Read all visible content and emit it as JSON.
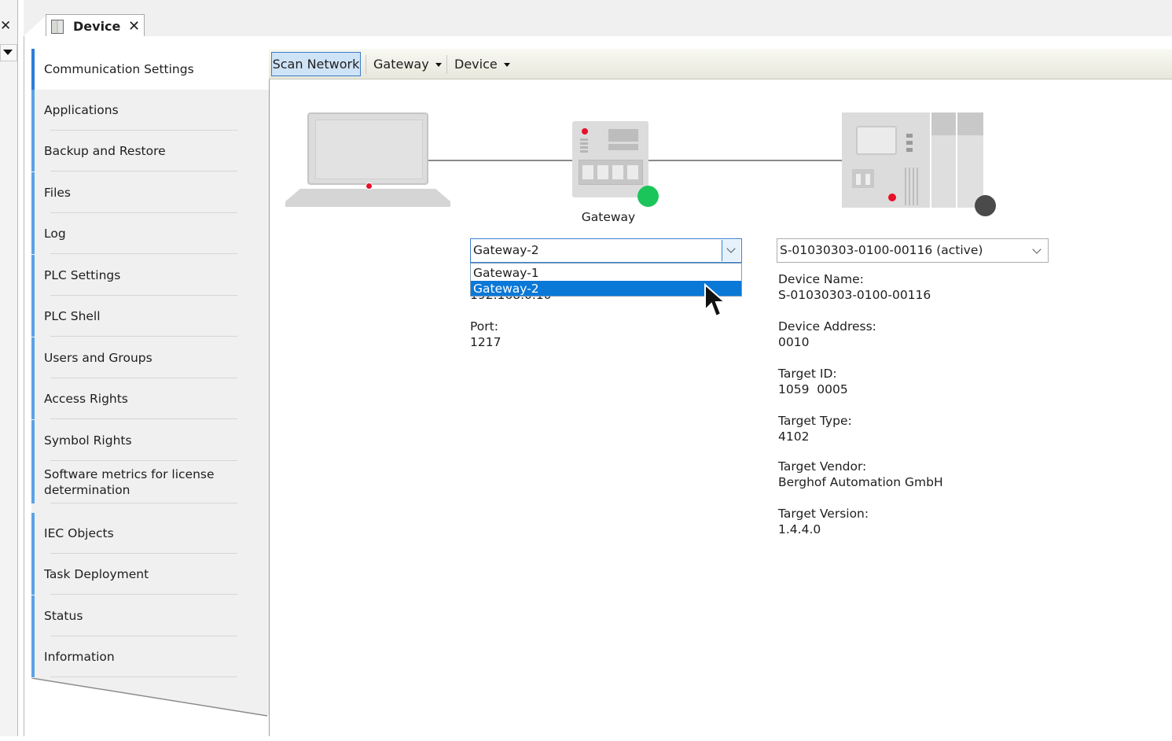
{
  "window": {
    "tab_label": "Device",
    "tab_close": "✕",
    "strip_close": "✕"
  },
  "nav": {
    "items": [
      "Communication Settings",
      "Applications",
      "Backup and Restore",
      "Files",
      "Log",
      "PLC Settings",
      "PLC Shell",
      "Users and Groups",
      "Access Rights",
      "Symbol Rights",
      "Software metrics for license determination",
      "IEC Objects",
      "Task Deployment",
      "Status",
      "Information"
    ],
    "active_index": 0
  },
  "toolbar": {
    "scan_label": "Scan Network",
    "gateway_label": "Gateway",
    "device_label": "Device"
  },
  "diagram": {
    "gateway_label": "Gateway",
    "gateway_status_color": "#1bc55a",
    "device_status_color": "#4a4a4a"
  },
  "gateway": {
    "selected": "Gateway-2",
    "options": [
      "Gateway-1",
      "Gateway-2"
    ],
    "highlighted_option": "Gateway-2",
    "hidden_ip_partial": "192.168.0.10",
    "port_label": "Port:",
    "port_value": "1217"
  },
  "device": {
    "selected": "S-01030303-0100-00116 (active)",
    "fields": [
      {
        "label": "Device Name:",
        "value": "S-01030303-0100-00116"
      },
      {
        "label": "Device Address:",
        "value": "0010"
      },
      {
        "label": "Target ID:",
        "value": "1059  0005"
      },
      {
        "label": "Target Type:",
        "value": "4102"
      },
      {
        "label": "Target Vendor:",
        "value": "Berghof Automation GmbH"
      },
      {
        "label": "Target Version:",
        "value": "1.4.4.0"
      }
    ]
  },
  "colors": {
    "accent": "#0a78d7",
    "nav_marker": "#5ba2e6",
    "scan_button_bg": "#cfe3f7"
  }
}
